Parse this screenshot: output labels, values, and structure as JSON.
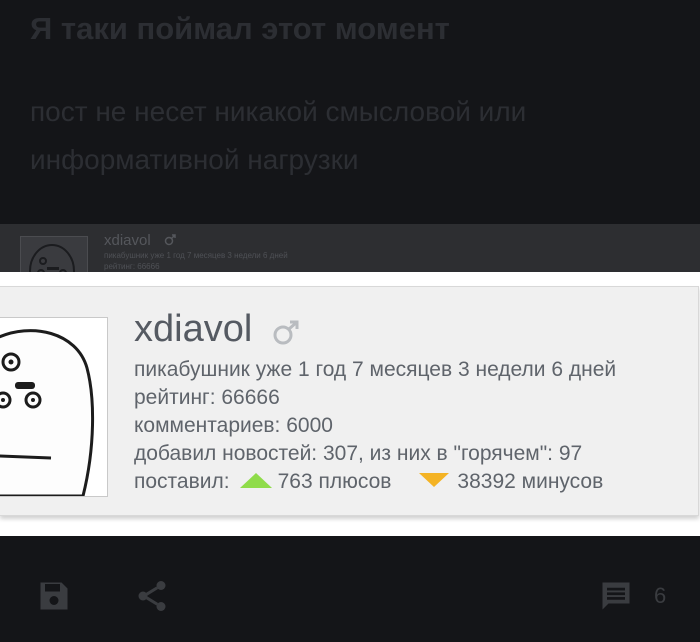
{
  "post": {
    "title": "Я таки поймал этот момент",
    "body": "пост не несет никакой смысловой или информативной нагрузки"
  },
  "image": {
    "thumbnail": {
      "username": "xdiavol",
      "line1": "пикабушник уже 1 год 7 месяцев 3 недели 6 дней",
      "line2": "рейтинг: 66666"
    },
    "card": {
      "username": "xdiavol",
      "gender_icon": "male-symbol-icon",
      "member_since": "пикабушник уже 1 год 7 месяцев 3 недели 6 дней",
      "rating": "рейтинг: 66666",
      "comments": "комментариев: 6000",
      "news": "добавил новостей: 307, из них в \"горячем\": 97",
      "voted_label": "поставил:",
      "pluses": "763 плюсов",
      "minuses": "38392 минусов",
      "colors": {
        "plus": "#8fdc4a",
        "minus": "#f4b324"
      }
    }
  },
  "actions": {
    "save_icon": "floppy-disk-icon",
    "share_icon": "share-icon",
    "comments_icon": "comment-icon",
    "comments_count": "6"
  }
}
